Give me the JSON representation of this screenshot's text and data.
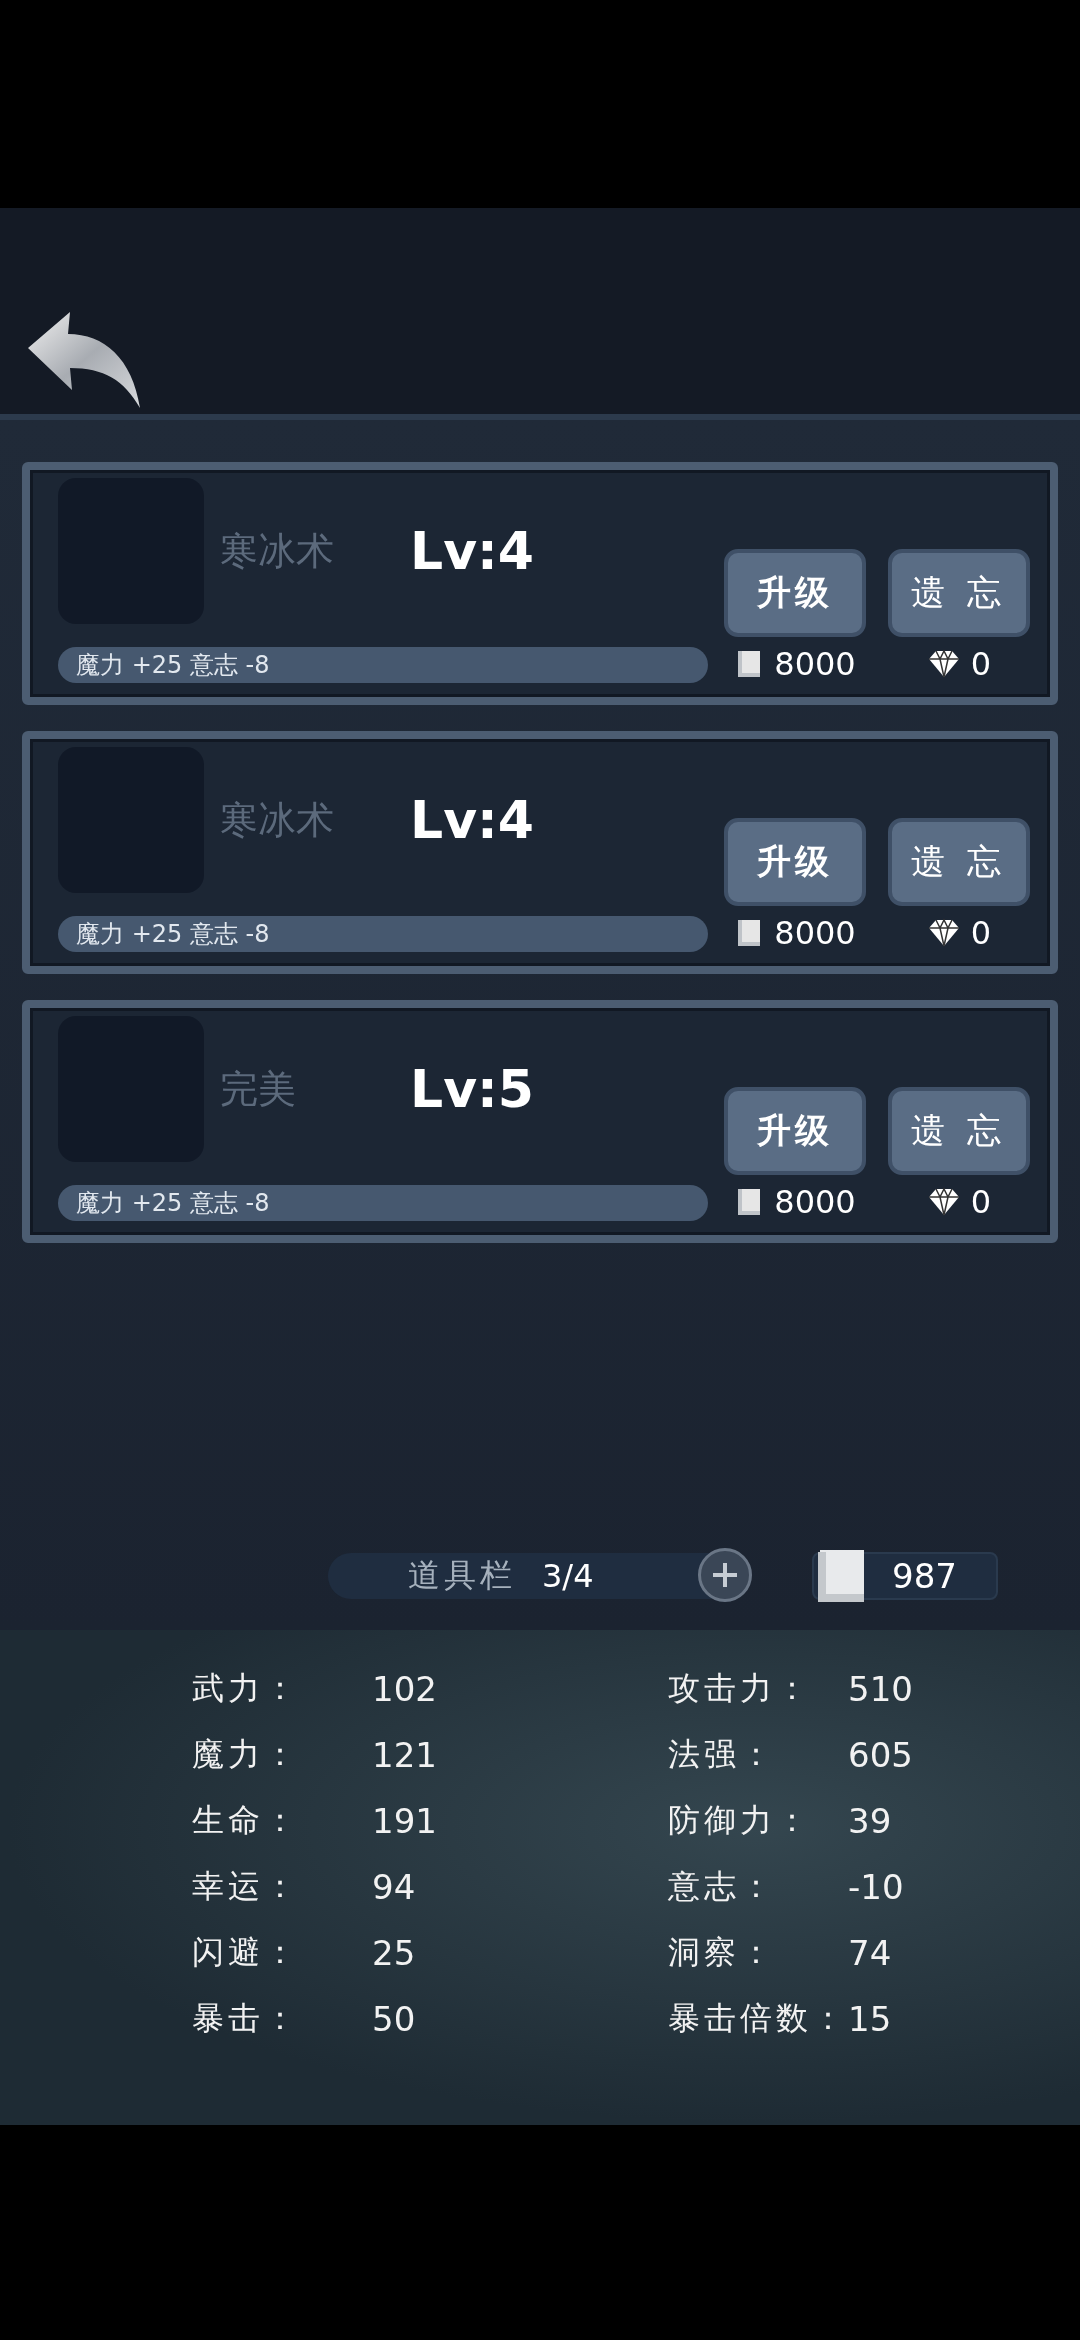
{
  "skills": [
    {
      "name": "寒冰术",
      "level": "Lv:4",
      "effect": "魔力 +25 意志 -8",
      "upgrade": "升级",
      "forget": "遗 忘",
      "book_cost": "8000",
      "gem_cost": "0"
    },
    {
      "name": "寒冰术",
      "level": "Lv:4",
      "effect": "魔力 +25 意志 -8",
      "upgrade": "升级",
      "forget": "遗 忘",
      "book_cost": "8000",
      "gem_cost": "0"
    },
    {
      "name": "完美",
      "level": "Lv:5",
      "effect": "魔力 +25 意志 -8",
      "upgrade": "升级",
      "forget": "遗 忘",
      "book_cost": "8000",
      "gem_cost": "0"
    }
  ],
  "inventory": {
    "label": "道具栏",
    "count": "3/4"
  },
  "books": "987",
  "stats": [
    {
      "label": "武力：",
      "value": "102"
    },
    {
      "label": "攻击力：",
      "value": "510"
    },
    {
      "label": "魔力：",
      "value": "121"
    },
    {
      "label": "法强：",
      "value": "605"
    },
    {
      "label": "生命：",
      "value": "191"
    },
    {
      "label": "防御力：",
      "value": "39"
    },
    {
      "label": "幸运：",
      "value": "94"
    },
    {
      "label": "意志：",
      "value": "-10"
    },
    {
      "label": "闪避：",
      "value": "25"
    },
    {
      "label": "洞察：",
      "value": "74"
    },
    {
      "label": "暴击：",
      "value": "50"
    },
    {
      "label": "暴击倍数：",
      "value": "15"
    }
  ]
}
